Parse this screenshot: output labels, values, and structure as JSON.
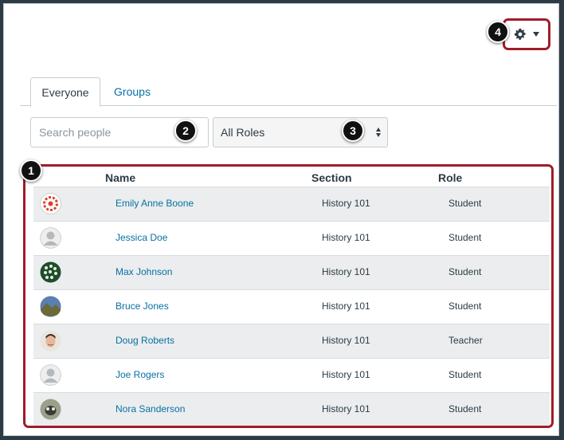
{
  "header": {
    "menu_caret": "▾"
  },
  "callouts": {
    "c1": "1",
    "c2": "2",
    "c3": "3",
    "c4": "4"
  },
  "tabs": [
    {
      "label": "Everyone",
      "active": true
    },
    {
      "label": "Groups",
      "active": false
    }
  ],
  "filters": {
    "search_placeholder": "Search people",
    "role_selected": "All Roles"
  },
  "table": {
    "columns": [
      "Name",
      "Section",
      "Role"
    ],
    "rows": [
      {
        "avatar": "avatar-red-logo",
        "name": "Emily Anne Boone",
        "section": "History 101",
        "role": "Student"
      },
      {
        "avatar": "avatar-default",
        "name": "Jessica Doe",
        "section": "History 101",
        "role": "Student"
      },
      {
        "avatar": "avatar-green-pattern",
        "name": "Max Johnson",
        "section": "History 101",
        "role": "Student"
      },
      {
        "avatar": "avatar-landscape",
        "name": "Bruce Jones",
        "section": "History 101",
        "role": "Student"
      },
      {
        "avatar": "avatar-face",
        "name": "Doug Roberts",
        "section": "History 101",
        "role": "Teacher"
      },
      {
        "avatar": "avatar-default",
        "name": "Joe Rogers",
        "section": "History 101",
        "role": "Student"
      },
      {
        "avatar": "avatar-animal",
        "name": "Nora Sanderson",
        "section": "History 101",
        "role": "Student"
      }
    ]
  },
  "colors": {
    "link": "#0770a3",
    "highlight_border": "#a01c2a",
    "row_alt": "#ebedee"
  }
}
